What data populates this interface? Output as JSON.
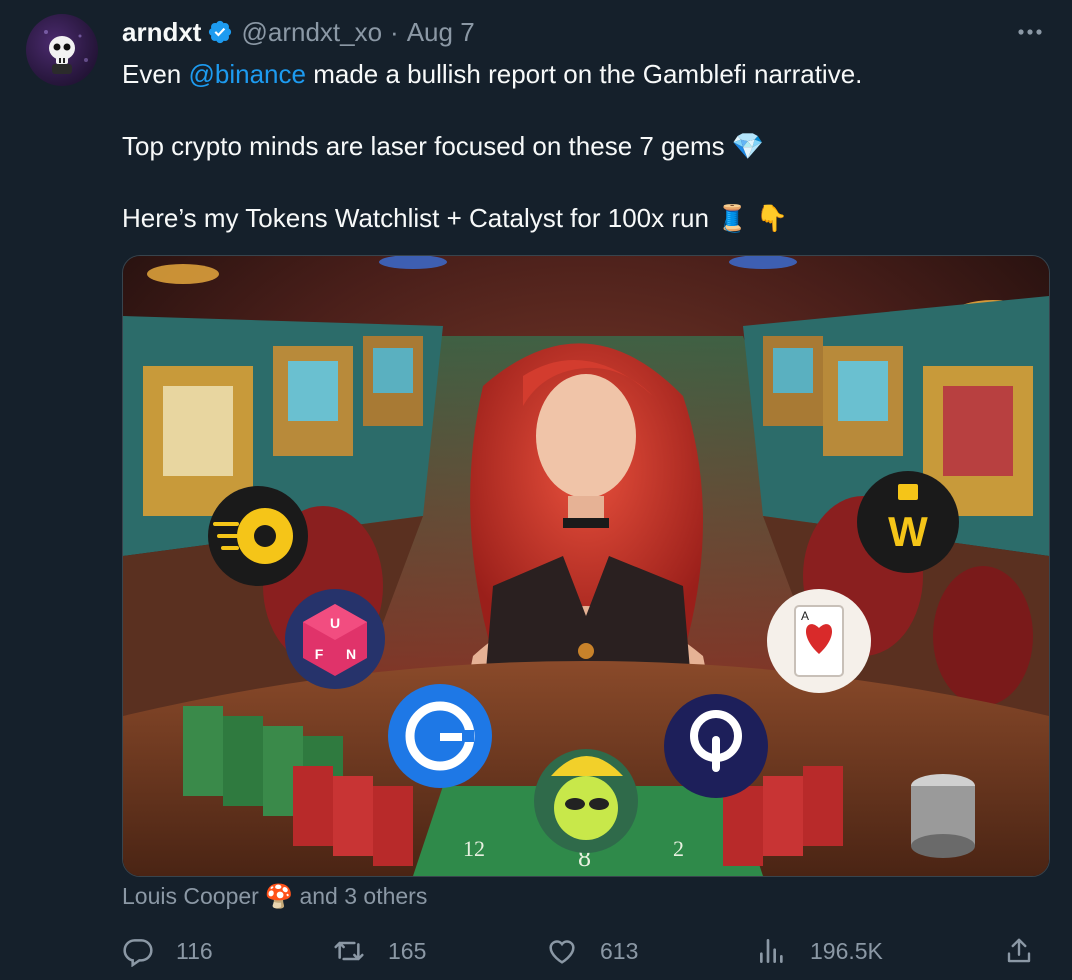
{
  "tweet": {
    "author_name": "arndxt",
    "handle": "@arndxt_xo",
    "separator": "·",
    "date": "Aug 7",
    "text_line1_prefix": "Even ",
    "mention": "@binance",
    "text_line1_suffix": " made a bullish report on the Gamblefi narrative.",
    "text_line2": "Top crypto minds are laser focused on these 7 gems 💎",
    "text_line3": "Here’s my Tokens Watchlist + Catalyst for 100x run 🧵 👇",
    "liked_by_name": "Louis Cooper",
    "liked_by_emoji": "🍄",
    "liked_by_suffix": "and 3 others",
    "replies": "116",
    "retweets": "165",
    "likes": "613",
    "views": "196.5K"
  },
  "colors": {
    "background": "#15202b",
    "text": "#f7f9f9",
    "secondary": "#8b98a5",
    "accent": "#1d9bf0"
  },
  "icons": [
    "verified-badge-icon",
    "more-options-icon",
    "reply-icon",
    "retweet-icon",
    "like-icon",
    "views-icon",
    "share-icon"
  ],
  "media": {
    "tokens": [
      "W",
      "FUN",
      "G"
    ]
  }
}
